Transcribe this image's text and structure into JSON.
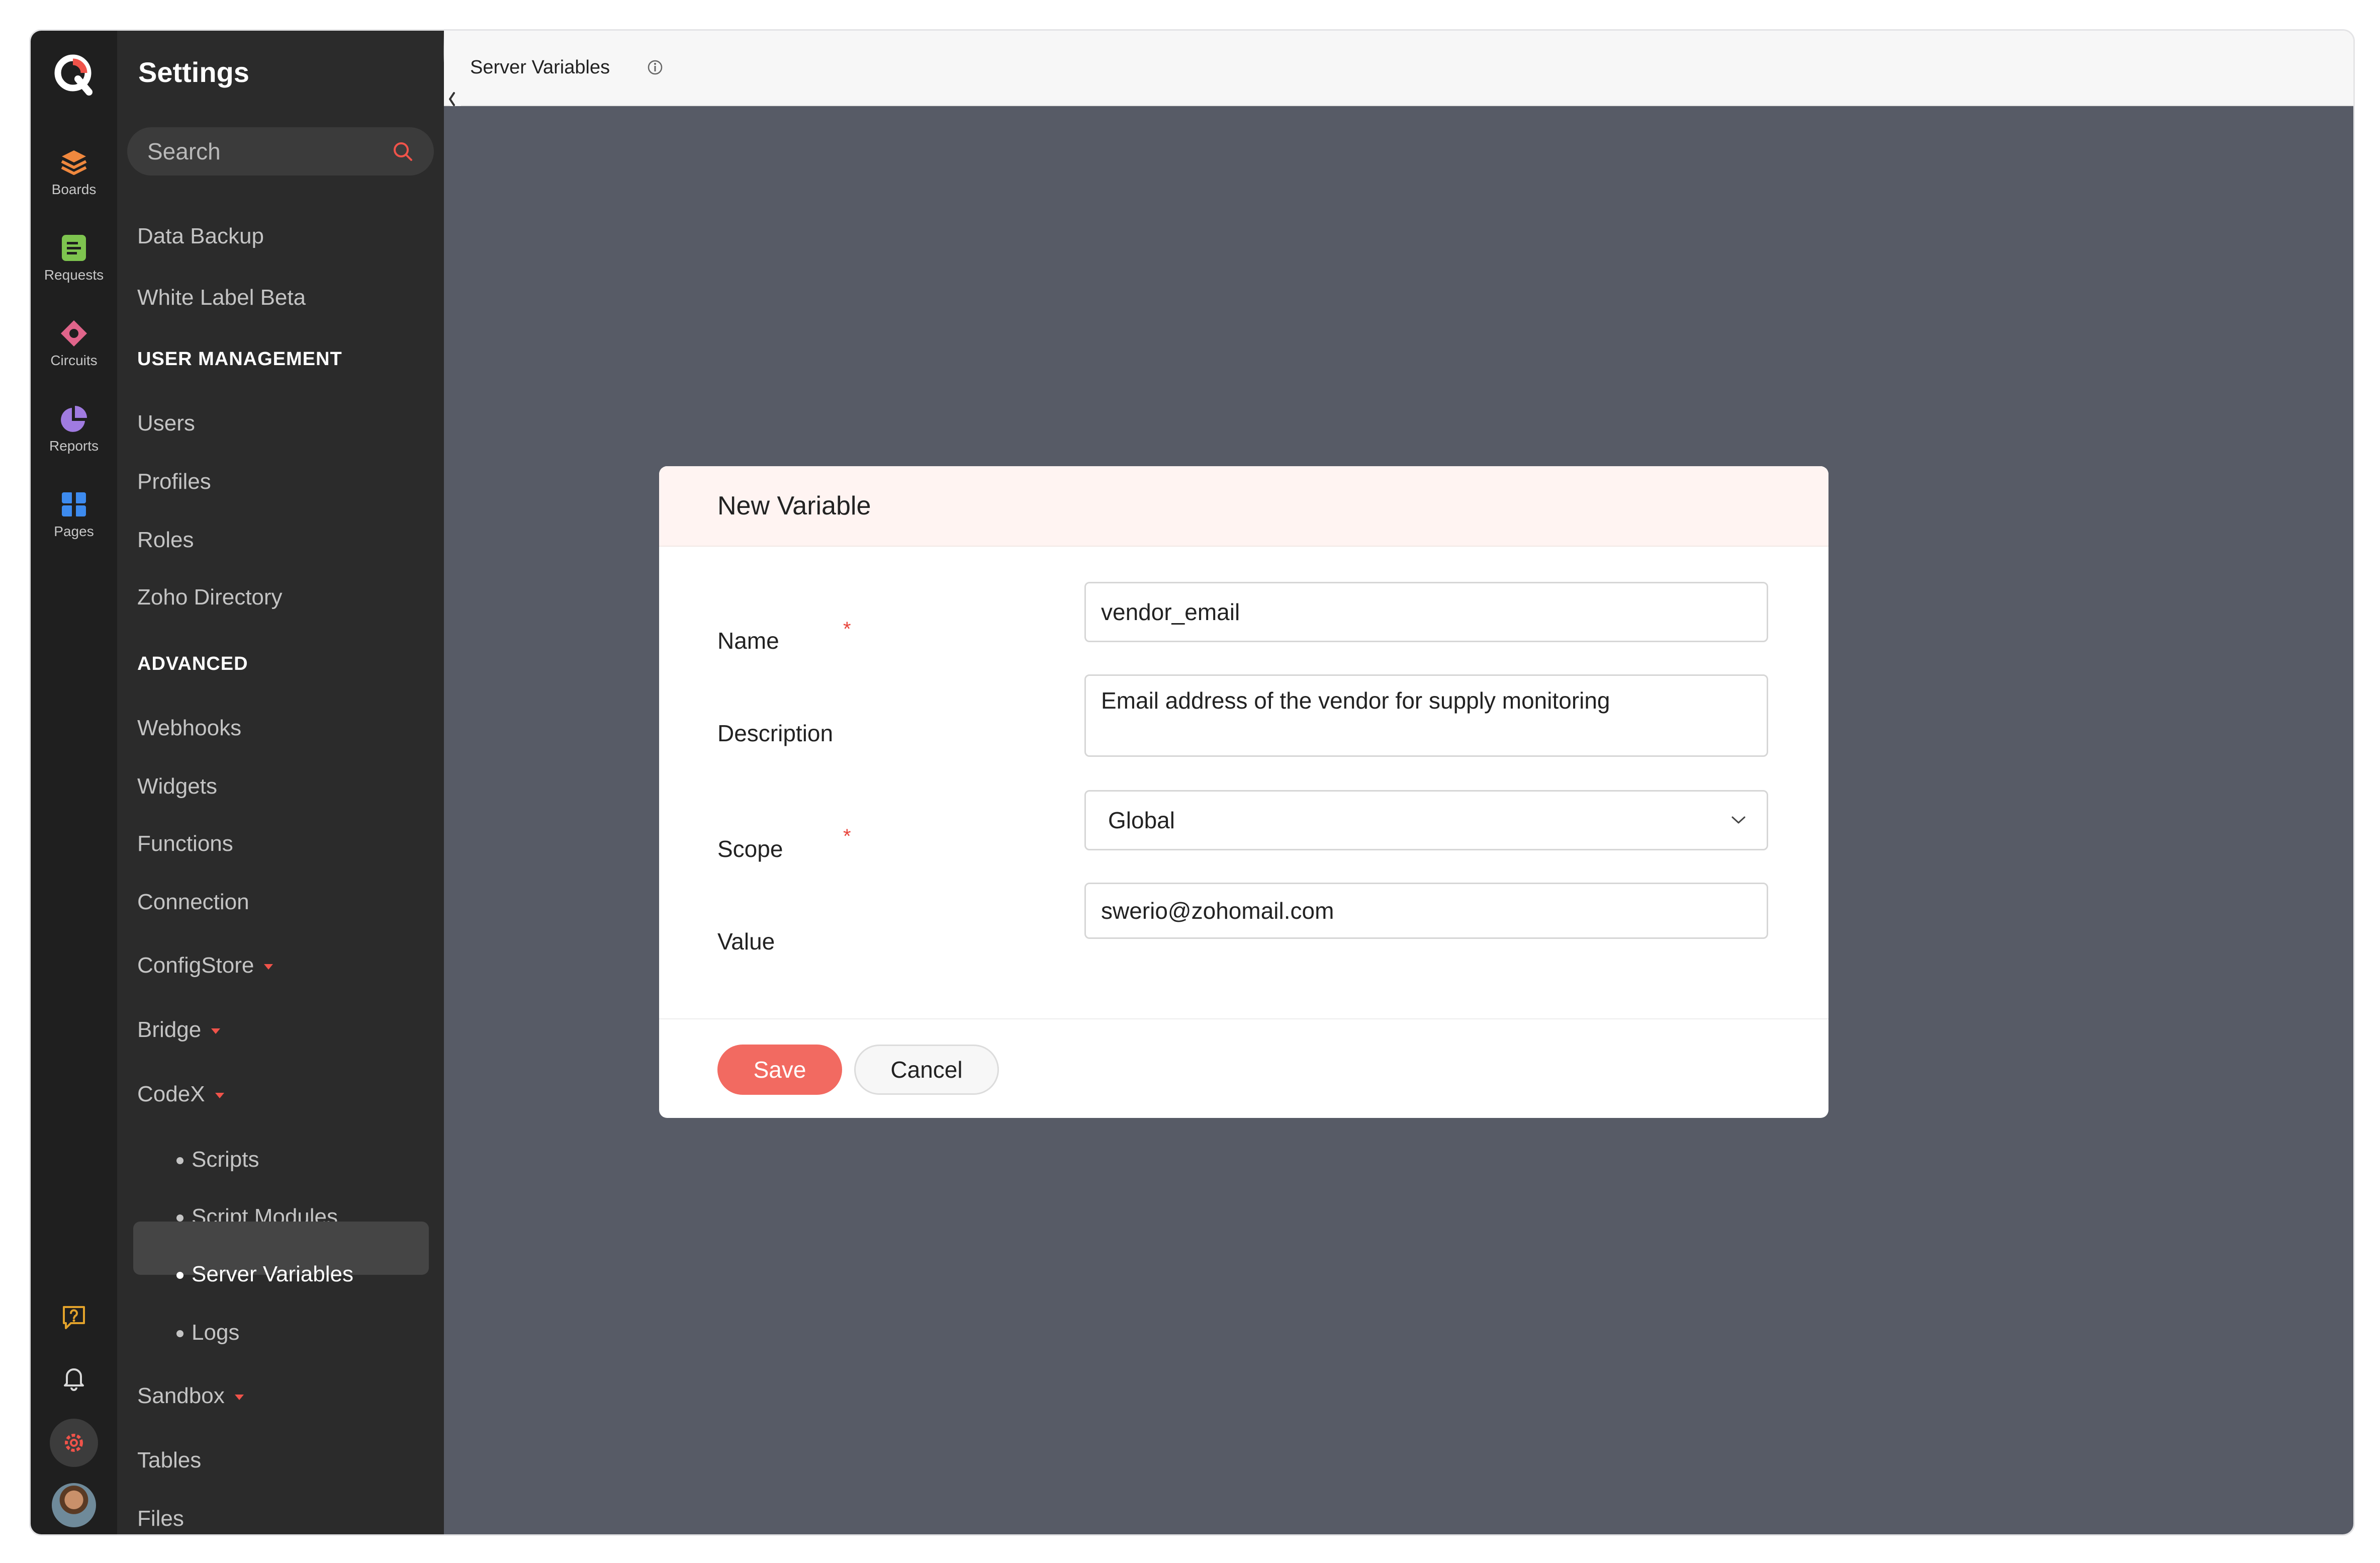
{
  "app": {
    "rail": [
      {
        "label": "Boards",
        "icon": "boards-icon",
        "color": "#f0883e"
      },
      {
        "label": "Requests",
        "icon": "requests-icon",
        "color": "#7ec44f"
      },
      {
        "label": "Circuits",
        "icon": "circuits-icon",
        "color": "#e0648a"
      },
      {
        "label": "Reports",
        "icon": "reports-icon",
        "color": "#a07be0"
      },
      {
        "label": "Pages",
        "icon": "pages-icon",
        "color": "#3d8bef"
      }
    ]
  },
  "settings": {
    "title": "Settings",
    "search_placeholder": "Search",
    "items_top": [
      "Data Backup",
      "White Label Beta"
    ],
    "user_management": {
      "heading": "USER MANAGEMENT",
      "items": [
        "Users",
        "Profiles",
        "Roles",
        "Zoho Directory"
      ]
    },
    "advanced": {
      "heading": "ADVANCED",
      "items": [
        "Webhooks",
        "Widgets",
        "Functions",
        "Connection"
      ],
      "configstore": "ConfigStore",
      "bridge": "Bridge",
      "codex": "CodeX",
      "codex_children": [
        "Scripts",
        "Script Modules",
        "Server Variables",
        "Logs"
      ],
      "active_child": "Server Variables",
      "sandbox": "Sandbox",
      "tables": "Tables",
      "files": "Files"
    }
  },
  "header": {
    "title": "Server Variables"
  },
  "modal": {
    "title": "New Variable",
    "fields": {
      "name": {
        "label": "Name",
        "required_mark": "*",
        "value": "vendor_email"
      },
      "description": {
        "label": "Description",
        "value": "Email address of the vendor for supply monitoring"
      },
      "scope": {
        "label": "Scope",
        "required_mark": "*",
        "value": "Global"
      },
      "value": {
        "label": "Value",
        "value": "swerio@zohomail.com"
      }
    },
    "save_label": "Save",
    "cancel_label": "Cancel"
  },
  "colors": {
    "accent": "#f26a61",
    "required": "#e8453c",
    "overlay": "#575b66"
  }
}
